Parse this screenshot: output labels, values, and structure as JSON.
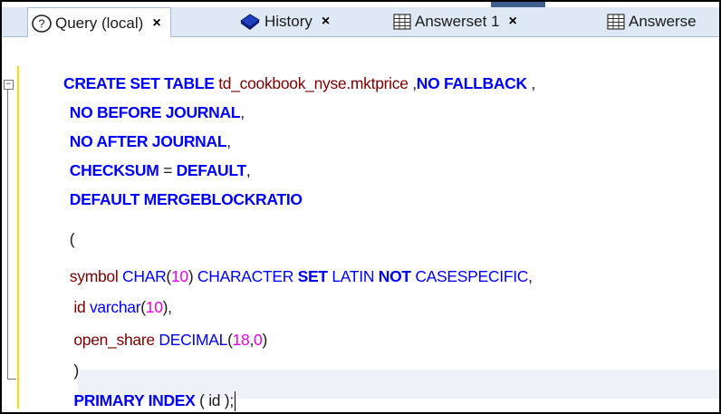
{
  "tabs": [
    {
      "label": "Query (local)",
      "icon": "help-circle-icon",
      "active": true
    },
    {
      "label": "History",
      "icon": "book-icon",
      "active": false
    },
    {
      "label": "Answerset 1",
      "icon": "grid-icon",
      "active": false
    },
    {
      "label": "Answerse",
      "icon": "grid-icon",
      "active": false
    }
  ],
  "close_glyph": "×",
  "editor": {
    "collapse_glyph": "−",
    "lines": [
      [
        {
          "t": "CREATE SET TABLE",
          "c": "kw"
        },
        {
          "t": " td_cookbook_nyse.mktprice ",
          "c": "id"
        },
        {
          "t": ",",
          "c": "pn"
        },
        {
          "t": "NO FALLBACK",
          "c": "kw"
        },
        {
          "t": " ,",
          "c": "pn"
        }
      ],
      [
        {
          "t": "     NO BEFORE JOURNAL",
          "c": "kw"
        },
        {
          "t": ",",
          "c": "pn"
        }
      ],
      [
        {
          "t": "     NO AFTER JOURNAL",
          "c": "kw"
        },
        {
          "t": ",",
          "c": "pn"
        }
      ],
      [
        {
          "t": "     CHECKSUM",
          "c": "kw"
        },
        {
          "t": " = ",
          "c": "pn"
        },
        {
          "t": "DEFAULT",
          "c": "kw"
        },
        {
          "t": ",",
          "c": "pn"
        }
      ],
      [
        {
          "t": "     DEFAULT MERGEBLOCKRATIO",
          "c": "kw"
        }
      ],
      [
        {
          "t": "     (",
          "c": "pn"
        }
      ],
      [
        {
          "t": "     symbol ",
          "c": "id"
        },
        {
          "t": "CHAR",
          "c": "tp"
        },
        {
          "t": "(",
          "c": "pn"
        },
        {
          "t": "10",
          "c": "num"
        },
        {
          "t": ") ",
          "c": "pn"
        },
        {
          "t": "CHARACTER ",
          "c": "tp"
        },
        {
          "t": "SET",
          "c": "kw"
        },
        {
          "t": " LATIN ",
          "c": "tp"
        },
        {
          "t": "NOT",
          "c": "kw"
        },
        {
          "t": " CASESPECIFIC",
          "c": "tp"
        },
        {
          "t": ",",
          "c": "pn"
        }
      ],
      [
        {
          "t": "      id ",
          "c": "id"
        },
        {
          "t": "varchar",
          "c": "tp"
        },
        {
          "t": "(",
          "c": "pn"
        },
        {
          "t": "10",
          "c": "num"
        },
        {
          "t": "),",
          "c": "pn"
        }
      ],
      [
        {
          "t": "      open_share ",
          "c": "id"
        },
        {
          "t": "DECIMAL",
          "c": "tp"
        },
        {
          "t": "(",
          "c": "pn"
        },
        {
          "t": "18",
          "c": "num"
        },
        {
          "t": ",",
          "c": "pn"
        },
        {
          "t": "0",
          "c": "num"
        },
        {
          "t": ")",
          "c": "pn"
        }
      ],
      [
        {
          "t": "      )",
          "c": "pn"
        }
      ],
      [
        {
          "t": "      PRIMARY INDEX",
          "c": "kw"
        },
        {
          "t": " ( id );",
          "c": "pn"
        }
      ]
    ]
  }
}
